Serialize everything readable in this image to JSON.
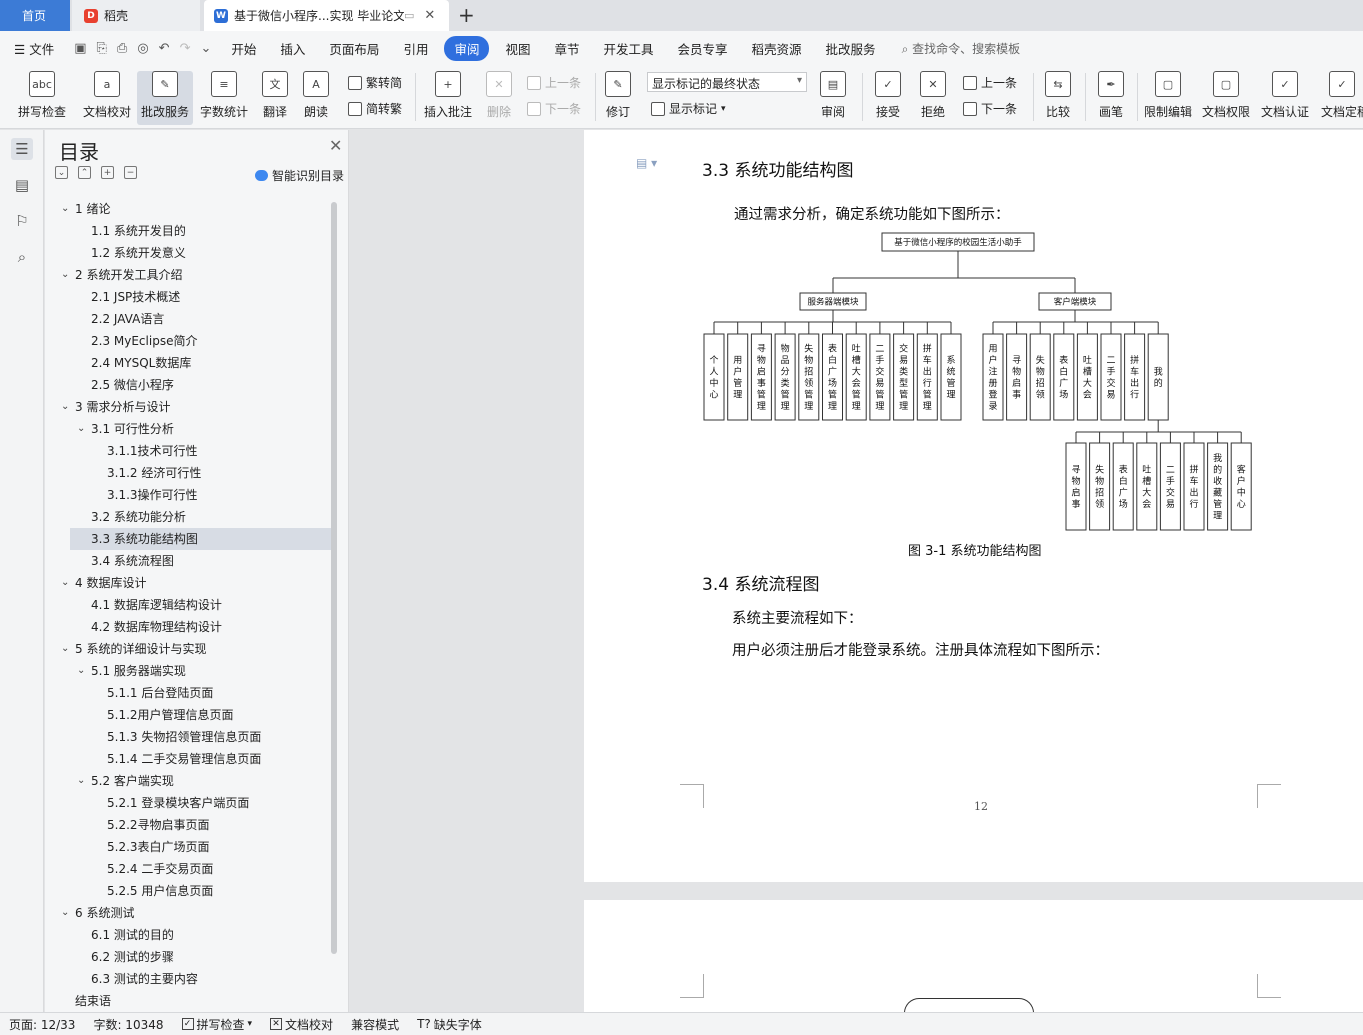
{
  "tabs": {
    "home": "首页",
    "daoke": "稻壳",
    "doc": "基于微信小程序...实现 毕业论文"
  },
  "menu": {
    "file": "文件",
    "items": [
      "开始",
      "插入",
      "页面布局",
      "引用",
      "审阅",
      "视图",
      "章节",
      "开发工具",
      "会员专享",
      "稻壳资源",
      "批改服务"
    ],
    "active_index": 4,
    "search": "查找命令、搜索模板"
  },
  "ribbon": {
    "spell": "拼写检查",
    "proof": "文档校对",
    "correct": "批改服务",
    "wordcount": "字数统计",
    "translate": "翻译",
    "read": "朗读",
    "trad": "繁转简",
    "simp": "简转繁",
    "insert_comment": "插入批注",
    "delete": "删除",
    "prev": "上一条",
    "next": "下一条",
    "track": "修订",
    "markup_state": "显示标记的最终状态",
    "show_markup": "显示标记",
    "review": "审阅",
    "accept": "接受",
    "reject": "拒绝",
    "prev2": "上一条",
    "next2": "下一条",
    "compare": "比较",
    "pen": "画笔",
    "restrict": "限制编辑",
    "rights": "文档权限",
    "auth": "文档认证",
    "finalize": "文档定稿"
  },
  "toc": {
    "title": "目录",
    "smart": "智能识别目录",
    "items": [
      {
        "text": "1  绪论",
        "level": 1,
        "tw": "v"
      },
      {
        "text": "1.1  系统开发目的",
        "level": 2
      },
      {
        "text": "1.2  系统开发意义",
        "level": 2
      },
      {
        "text": "2  系统开发工具介绍",
        "level": 1,
        "tw": "v"
      },
      {
        "text": "2.1 JSP技术概述",
        "level": 2
      },
      {
        "text": "2.2 JAVA语言",
        "level": 2
      },
      {
        "text": "2.3 MyEclipse简介",
        "level": 2
      },
      {
        "text": "2.4 MYSQL数据库",
        "level": 2
      },
      {
        "text": "2.5  微信小程序",
        "level": 2
      },
      {
        "text": "3  需求分析与设计",
        "level": 1,
        "tw": "v"
      },
      {
        "text": "3.1  可行性分析",
        "level": 2,
        "tw": "v"
      },
      {
        "text": "3.1.1技术可行性",
        "level": 3
      },
      {
        "text": "3.1.2  经济可行性",
        "level": 3
      },
      {
        "text": "3.1.3操作可行性",
        "level": 3
      },
      {
        "text": "3.2  系统功能分析",
        "level": 2
      },
      {
        "text": "3.3  系统功能结构图",
        "level": 2,
        "selected": true
      },
      {
        "text": "3.4  系统流程图",
        "level": 2
      },
      {
        "text": "4  数据库设计",
        "level": 1,
        "tw": "v"
      },
      {
        "text": "4.1  数据库逻辑结构设计",
        "level": 2
      },
      {
        "text": "4.2  数据库物理结构设计",
        "level": 2
      },
      {
        "text": "5  系统的详细设计与实现",
        "level": 1,
        "tw": "v"
      },
      {
        "text": "5.1  服务器端实现",
        "level": 2,
        "tw": "v"
      },
      {
        "text": "5.1.1  后台登陆页面",
        "level": 3
      },
      {
        "text": "5.1.2用户管理信息页面",
        "level": 3
      },
      {
        "text": "5.1.3  失物招领管理信息页面",
        "level": 3
      },
      {
        "text": "5.1.4  二手交易管理信息页面",
        "level": 3
      },
      {
        "text": "5.2  客户端实现",
        "level": 2,
        "tw": "v"
      },
      {
        "text": "5.2.1  登录模块客户端页面",
        "level": 3
      },
      {
        "text": "5.2.2寻物启事页面",
        "level": 3
      },
      {
        "text": "5.2.3表白广场页面",
        "level": 3
      },
      {
        "text": "5.2.4  二手交易页面",
        "level": 3
      },
      {
        "text": "5.2.5  用户信息页面",
        "level": 3
      },
      {
        "text": "6  系统测试",
        "level": 1,
        "tw": "v"
      },
      {
        "text": "6.1  测试的目的",
        "level": 2
      },
      {
        "text": "6.2  测试的步骤",
        "level": 2
      },
      {
        "text": "6.3  测试的主要内容",
        "level": 2
      },
      {
        "text": "结束语",
        "level": 1
      }
    ]
  },
  "doc": {
    "h33": "3.3  系统功能结构图",
    "p1": "通过需求分析，确定系统功能如下图所示：",
    "diagram": {
      "root": "基于微信小程序的校园生活小助手",
      "server": "服务器端模块",
      "client": "客户端模块",
      "server_items": [
        "个人中心",
        "用户管理",
        "寻物启事管理",
        "物品分类管理",
        "失物招领管理",
        "表白广场管理",
        "吐槽大会管理",
        "二手交易管理",
        "交易类型管理",
        "拼车出行管理",
        "系统管理"
      ],
      "client_items": [
        "用户注册登录",
        "寻物启事",
        "失物招领",
        "表白广场",
        "吐槽大会",
        "二手交易",
        "拼车出行",
        "我的"
      ],
      "my_items": [
        "寻物启事",
        "失物招领",
        "表白广场",
        "吐槽大会",
        "二手交易",
        "拼车出行",
        "我的收藏管理",
        "客户中心"
      ]
    },
    "caption": "图 3-1  系统功能结构图",
    "h34": "3.4  系统流程图",
    "p2": "系统主要流程如下：",
    "p3": "用户必须注册后才能登录系统。注册具体流程如下图所示：",
    "page_no": "12"
  },
  "status": {
    "page": "页面: 12/33",
    "words": "字数: 10348",
    "spell": "拼写检查",
    "proof": "文档校对",
    "compat": "兼容模式",
    "font": "缺失字体"
  }
}
